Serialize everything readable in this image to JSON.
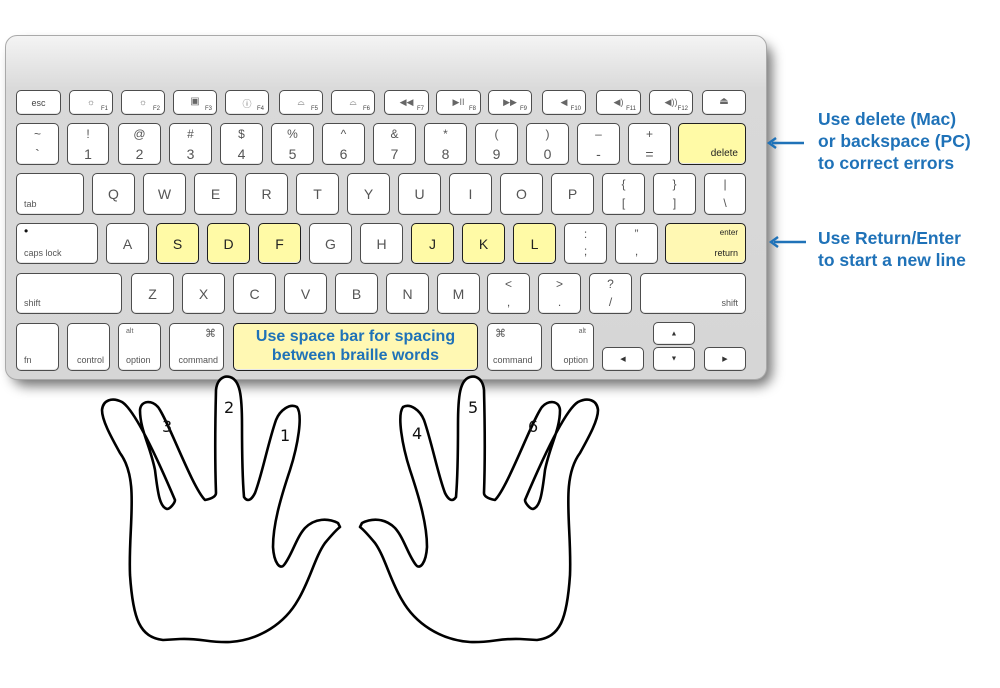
{
  "keyboard": {
    "function_row": [
      {
        "id": "esc",
        "label": "esc"
      },
      {
        "id": "f1",
        "icon": "brightness-down-icon",
        "glyph": "☼",
        "fn": "F1"
      },
      {
        "id": "f2",
        "icon": "brightness-up-icon",
        "glyph": "☼",
        "fn": "F2"
      },
      {
        "id": "f3",
        "icon": "mission-control-icon",
        "glyph": "▣",
        "fn": "F3"
      },
      {
        "id": "f4",
        "icon": "dashboard-icon",
        "glyph": "ⓘ",
        "fn": "F4"
      },
      {
        "id": "f5",
        "icon": "keyboard-light-down-icon",
        "glyph": "⌓",
        "fn": "F5"
      },
      {
        "id": "f6",
        "icon": "keyboard-light-up-icon",
        "glyph": "⌓",
        "fn": "F6"
      },
      {
        "id": "f7",
        "icon": "rewind-icon",
        "glyph": "◀◀",
        "fn": "F7"
      },
      {
        "id": "f8",
        "icon": "play-pause-icon",
        "glyph": "▶II",
        "fn": "F8"
      },
      {
        "id": "f9",
        "icon": "fast-forward-icon",
        "glyph": "▶▶",
        "fn": "F9"
      },
      {
        "id": "f10",
        "icon": "mute-icon",
        "glyph": "◀",
        "fn": "F10"
      },
      {
        "id": "f11",
        "icon": "volume-down-icon",
        "glyph": "◀)",
        "fn": "F11"
      },
      {
        "id": "f12",
        "icon": "volume-up-icon",
        "glyph": "◀))",
        "fn": "F12"
      },
      {
        "id": "eject",
        "icon": "eject-icon",
        "glyph": "⏏"
      }
    ],
    "number_row": [
      {
        "top": "~",
        "bottom": "`"
      },
      {
        "top": "!",
        "bottom": "1"
      },
      {
        "top": "@",
        "bottom": "2"
      },
      {
        "top": "#",
        "bottom": "3"
      },
      {
        "top": "$",
        "bottom": "4"
      },
      {
        "top": "%",
        "bottom": "5"
      },
      {
        "top": "^",
        "bottom": "6"
      },
      {
        "top": "&",
        "bottom": "7"
      },
      {
        "top": "*",
        "bottom": "8"
      },
      {
        "top": "(",
        "bottom": "9"
      },
      {
        "top": ")",
        "bottom": "0"
      },
      {
        "top": "–",
        "bottom": "-"
      },
      {
        "top": "+",
        "bottom": "="
      }
    ],
    "delete_label": "delete",
    "tab_label": "tab",
    "tab_row_letters": [
      "Q",
      "W",
      "E",
      "R",
      "T",
      "Y",
      "U",
      "I",
      "O",
      "P"
    ],
    "tab_row_symbols": [
      {
        "top": "{",
        "bottom": "["
      },
      {
        "top": "}",
        "bottom": "]"
      },
      {
        "top": "|",
        "bottom": "\\"
      }
    ],
    "caps_lock_label": "caps lock",
    "caps_lock_indicator": "•",
    "home_row_letters": [
      "A",
      "S",
      "D",
      "F",
      "G",
      "H",
      "J",
      "K",
      "L"
    ],
    "home_row_highlighted": [
      "S",
      "D",
      "F",
      "J",
      "K",
      "L"
    ],
    "home_row_symbols": [
      {
        "top": ":",
        "bottom": ";"
      },
      {
        "top": "”",
        "bottom": ","
      }
    ],
    "return_key": {
      "top": "enter",
      "bottom": "return"
    },
    "shift_label": "shift",
    "shift_row_letters": [
      "Z",
      "X",
      "C",
      "V",
      "B",
      "N",
      "M"
    ],
    "shift_row_symbols": [
      {
        "top": "<",
        "bottom": ","
      },
      {
        "top": ">",
        "bottom": "."
      },
      {
        "top": "?",
        "bottom": "/"
      }
    ],
    "bottom_row": {
      "fn": "fn",
      "control": "control",
      "option": {
        "top": "alt",
        "bottom": "option"
      },
      "command": {
        "symbol": "⌘",
        "label": "command"
      },
      "space_bar_text": [
        "Use space bar for spacing",
        "between braille words"
      ],
      "arrows": {
        "left": "◀",
        "up": "▲",
        "down": "▼",
        "right": "▶"
      }
    }
  },
  "annotations": {
    "delete_note": [
      "Use delete (Mac)",
      "or backspace (PC)",
      "to correct errors"
    ],
    "return_note": [
      "Use Return/Enter",
      "to start a new line"
    ]
  },
  "hands": {
    "left_fingers": [
      "3",
      "2",
      "1"
    ],
    "right_fingers": [
      "4",
      "5",
      "6"
    ]
  },
  "colors": {
    "highlight_key": "#fffaa6",
    "annotation_text": "#1f72b8",
    "key_border": "#4d4d4d"
  }
}
